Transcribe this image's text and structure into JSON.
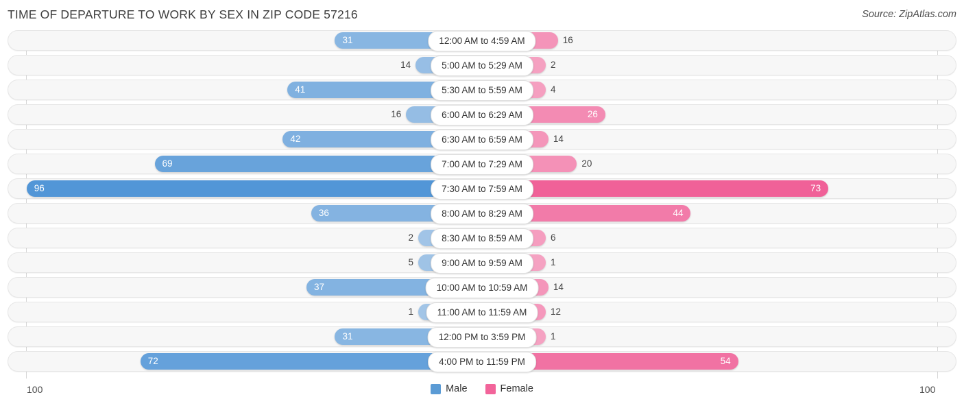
{
  "header": {
    "title": "TIME OF DEPARTURE TO WORK BY SEX IN ZIP CODE 57216",
    "source": "Source: ZipAtlas.com"
  },
  "axis": {
    "left_max_label": "100",
    "right_max_label": "100"
  },
  "legend": {
    "items": [
      {
        "label": "Male",
        "color": "#5b9bd5"
      },
      {
        "label": "Female",
        "color": "#f2649a"
      }
    ]
  },
  "colors": {
    "male_strong": "#5b9bd5",
    "male_light": "#a8c8e8",
    "female_strong": "#ef5d92",
    "female_light": "#f6a8c6",
    "track_bg": "#f7f7f7",
    "gridline": "#d7d7d7"
  },
  "chart_data": {
    "type": "bar",
    "title": "TIME OF DEPARTURE TO WORK BY SEX IN ZIP CODE 57216",
    "subtitle": "",
    "xlabel": "",
    "ylabel": "",
    "orientation": "horizontal-diverging",
    "xlim": [
      100,
      0,
      100
    ],
    "grid": true,
    "legend_position": "bottom-center",
    "categories": [
      "12:00 AM to 4:59 AM",
      "5:00 AM to 5:29 AM",
      "5:30 AM to 5:59 AM",
      "6:00 AM to 6:29 AM",
      "6:30 AM to 6:59 AM",
      "7:00 AM to 7:29 AM",
      "7:30 AM to 7:59 AM",
      "8:00 AM to 8:29 AM",
      "8:30 AM to 8:59 AM",
      "9:00 AM to 9:59 AM",
      "10:00 AM to 10:59 AM",
      "11:00 AM to 11:59 AM",
      "12:00 PM to 3:59 PM",
      "4:00 PM to 11:59 PM"
    ],
    "series": [
      {
        "name": "Male",
        "color": "#5b9bd5",
        "side": "left",
        "values": [
          31,
          14,
          41,
          16,
          42,
          69,
          96,
          36,
          2,
          5,
          37,
          1,
          31,
          72
        ]
      },
      {
        "name": "Female",
        "color": "#ef5d92",
        "side": "right",
        "values": [
          16,
          2,
          4,
          26,
          14,
          20,
          73,
          44,
          6,
          1,
          14,
          12,
          1,
          54
        ]
      }
    ]
  }
}
